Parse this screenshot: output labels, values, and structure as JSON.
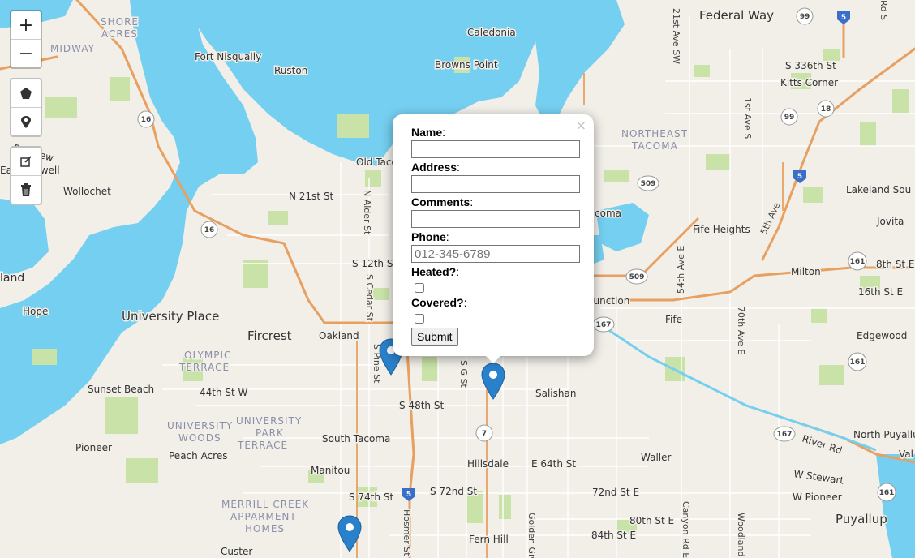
{
  "map": {
    "places": [
      "Federal Way",
      "SHORE",
      "ACRES",
      "MIDWAY",
      "Caledonia",
      "Fort Nisqually",
      "Ruston",
      "Browns Point",
      "S 336th St",
      "Kitts Corner",
      "NORTHEAST",
      "TACOMA",
      "Old Taco",
      "Wollochet",
      "N 21st St",
      "Lakeland Sou",
      "Jovita",
      "Fife Heights",
      "S 12th St",
      "Milton",
      "8th St E",
      "16th St E",
      "land",
      "Hope",
      "University Place",
      "Fircrest",
      "Oakland",
      "Fife",
      "Edgewood",
      "OLYMPIC",
      "TERRACE",
      "Sunset Beach",
      "44th St W",
      "S 48th St",
      "Salishan",
      "UNIVERSITY",
      "WOODS",
      "UNIVERSITY",
      "PARK",
      "TERRACE",
      "South Tacoma",
      "Pioneer",
      "Peach Acres",
      "Waller",
      "Hillsdale",
      "E 64th St",
      "Manitou",
      "S 74th St",
      "S 72nd St",
      "72nd St E",
      "W Stewart",
      "W Pioneer",
      "MERRILL CREEK",
      "APPARMENT",
      "HOMES",
      "80th St E",
      "84th St E",
      "Puyallup",
      "Fern Hill",
      "Custer",
      "North Puyallu",
      "River Rd",
      "Junction",
      "coma",
      "Ea",
      "mwell",
      "21st Ave SW",
      "1st Ave S",
      "N Alder St",
      "S Cedar St",
      "S Pine St",
      "S G St",
      "Canyon Rd E",
      "54th Ave E",
      "70th Ave E",
      "Golden Giv",
      "Woodland",
      "Hosmer St",
      "5th Ave",
      "Rd S",
      "Bayview",
      "Val"
    ],
    "shields": [
      "99",
      "5",
      "18",
      "99",
      "16",
      "16",
      "509",
      "509",
      "5",
      "167",
      "161",
      "161",
      "7",
      "5",
      "167",
      "161",
      "5"
    ]
  },
  "controls": {
    "zoom_in": "+",
    "zoom_out": "−",
    "polygon_icon": "polygon-icon",
    "marker_icon": "marker-icon",
    "edit_icon": "edit-icon",
    "delete_icon": "trash-icon"
  },
  "popup": {
    "close": "×",
    "fields": {
      "name_label": "Name",
      "address_label": "Address",
      "comments_label": "Comments",
      "phone_label": "Phone",
      "phone_placeholder": "012-345-6789",
      "heated_label": "Heated?",
      "covered_label": "Covered?"
    },
    "colon": ":",
    "submit": "Submit"
  },
  "colors": {
    "water": "#75cff0",
    "land": "#f2efe9",
    "park": "#c8e2a8",
    "highway": "#e8a060",
    "marker": "#2a81cb"
  }
}
